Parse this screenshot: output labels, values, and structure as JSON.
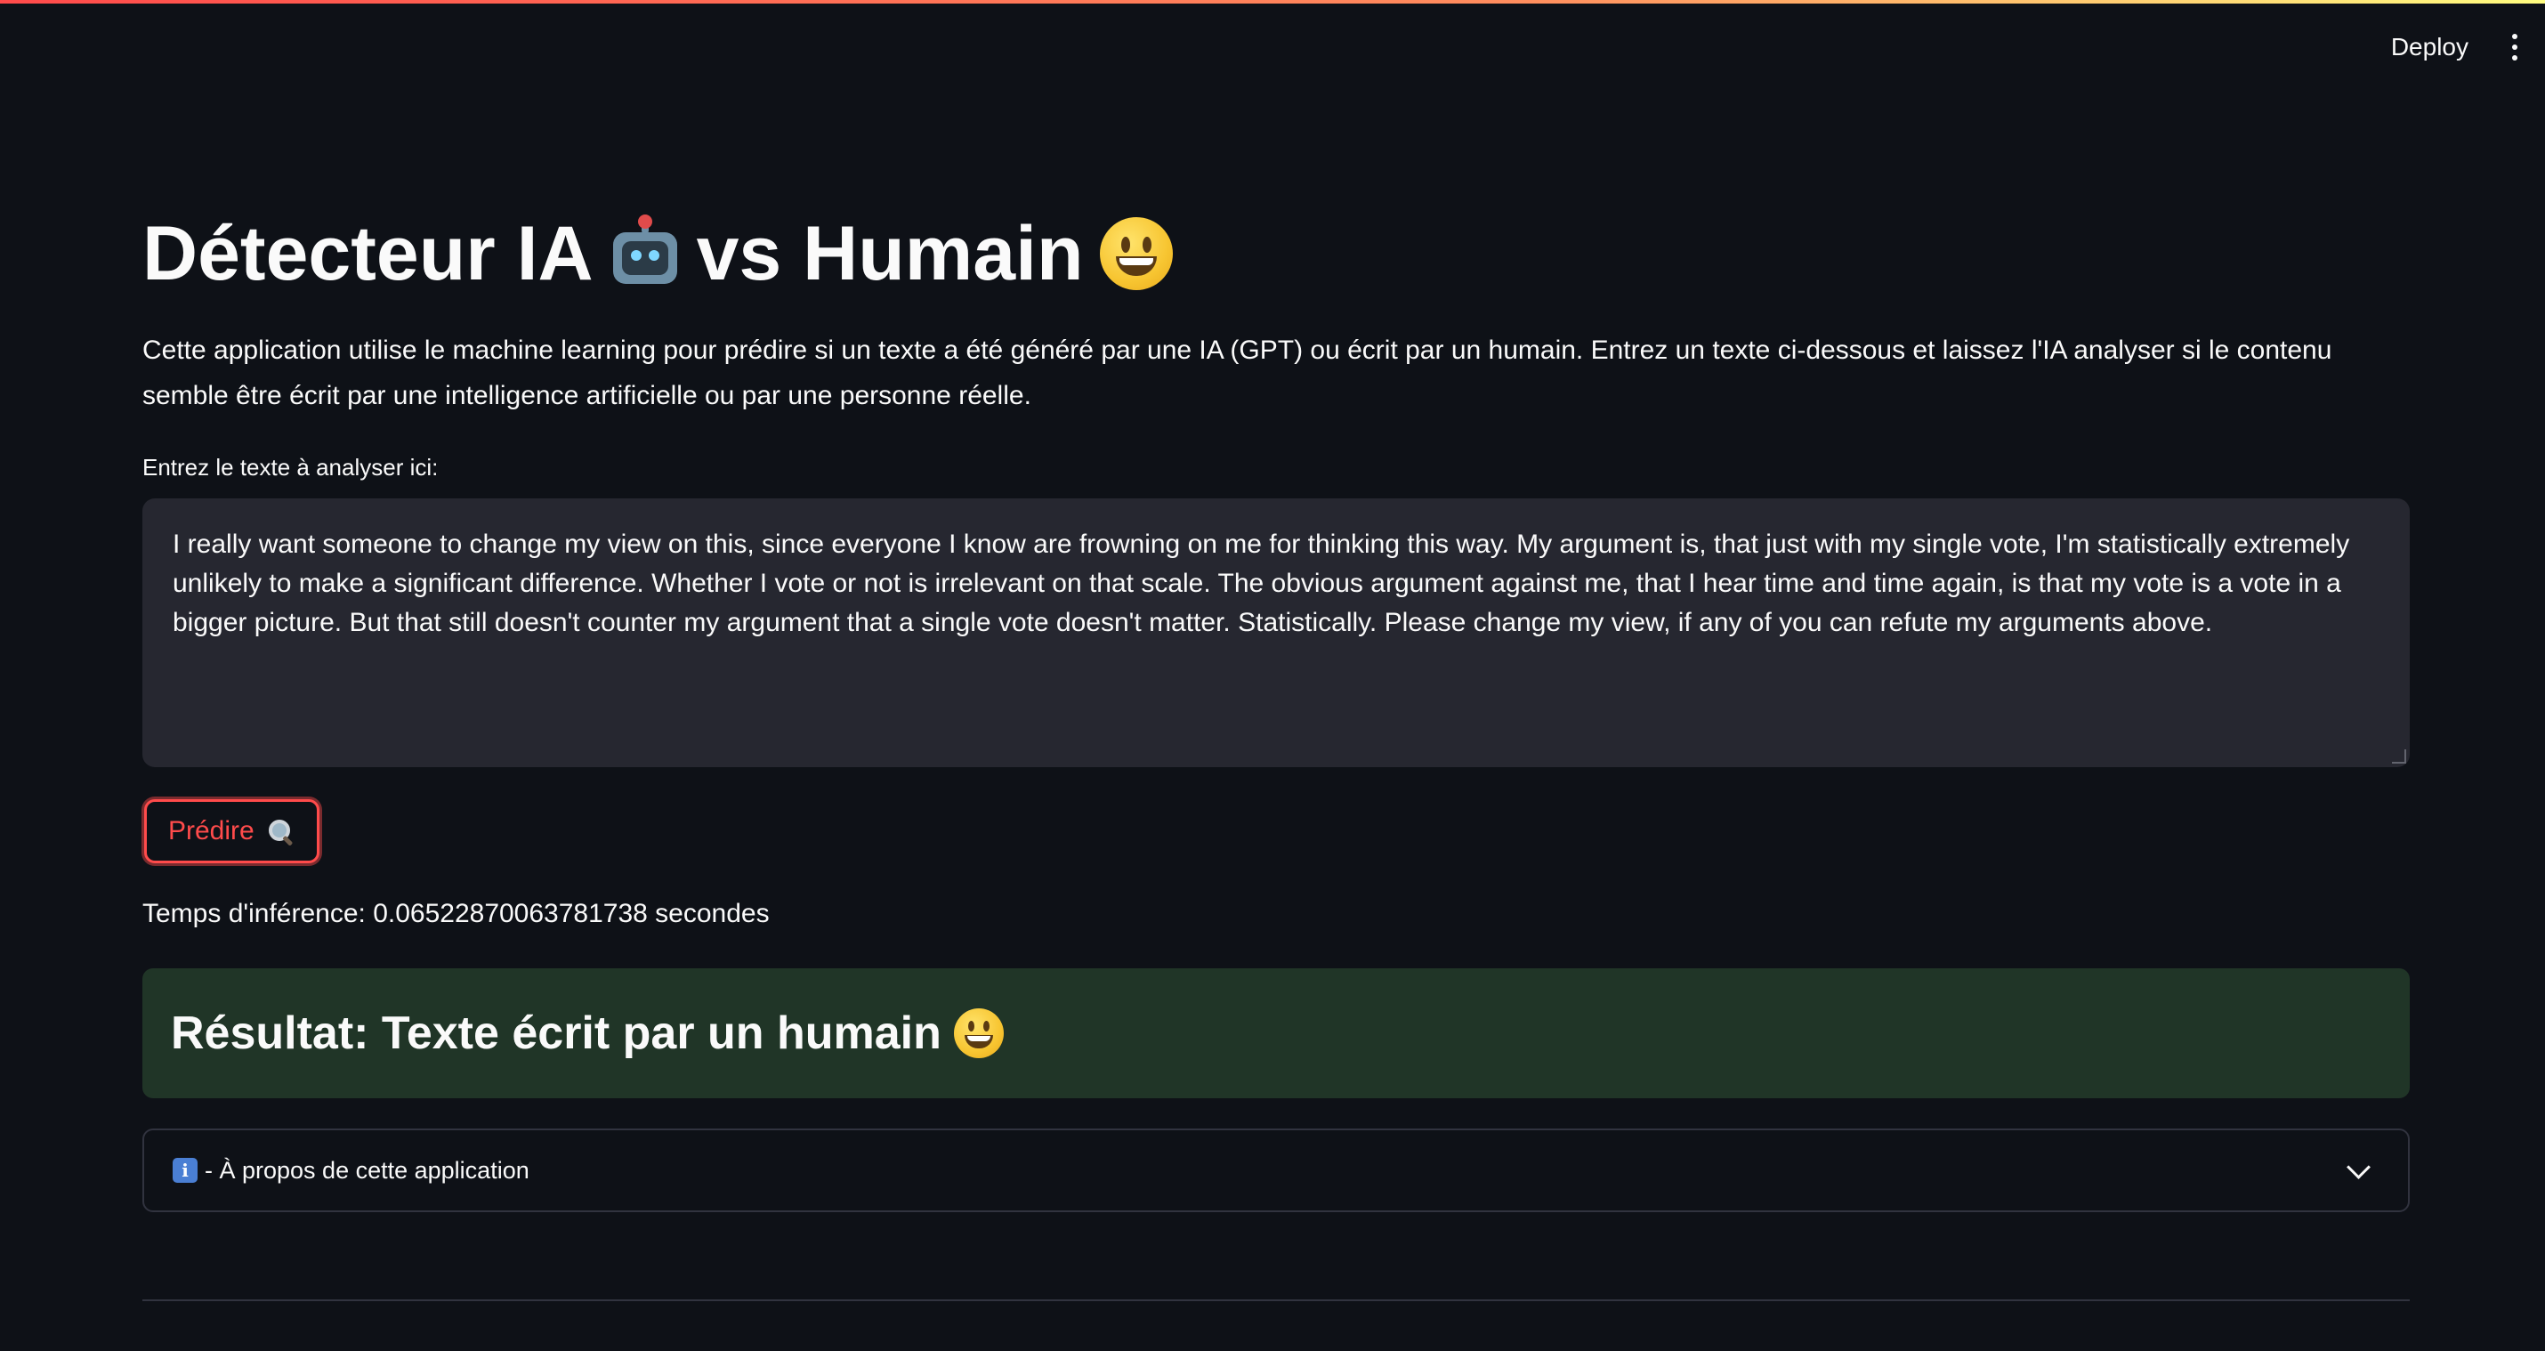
{
  "header": {
    "deploy_label": "Deploy",
    "menu_icon": "kebab-menu-icon"
  },
  "title": {
    "part1": "Détecteur IA",
    "emoji1": "robot-emoji",
    "part2": "vs Humain",
    "emoji2": "grinning-face-emoji"
  },
  "description": "Cette application utilise le machine learning pour prédire si un texte a été généré par une IA (GPT) ou écrit par un humain. Entrez un texte ci-dessous et laissez l'IA analyser si le contenu semble être écrit par une intelligence artificielle ou par une personne réelle.",
  "input": {
    "label": "Entrez le texte à analyser ici:",
    "value": "I really want someone to change my view on this, since everyone I know are frowning on me for thinking this way. My argument is, that just with my single vote, I'm statistically extremely unlikely to make a significant difference. Whether I vote or not is irrelevant on that scale. The obvious argument against me, that I hear time and time again, is that my vote is a vote in a bigger picture. But that still doesn't counter my argument that a single vote doesn't matter. Statistically. Please change my view, if any of you can refute my arguments above."
  },
  "predict_button": {
    "label": "Prédire",
    "icon": "magnifier-icon"
  },
  "inference_text": "Temps d'inférence: 0.06522870063781738 secondes",
  "result": {
    "text": "Résultat: Texte écrit par un humain",
    "emoji": "grinning-face-emoji",
    "accent_color": "#203527"
  },
  "expander": {
    "label": "- À propos de cette application",
    "icon": "info-icon",
    "icon_text": "i"
  },
  "colors": {
    "background": "#0e1117",
    "primary": "#ff4b4b",
    "input_bg": "#262730"
  }
}
